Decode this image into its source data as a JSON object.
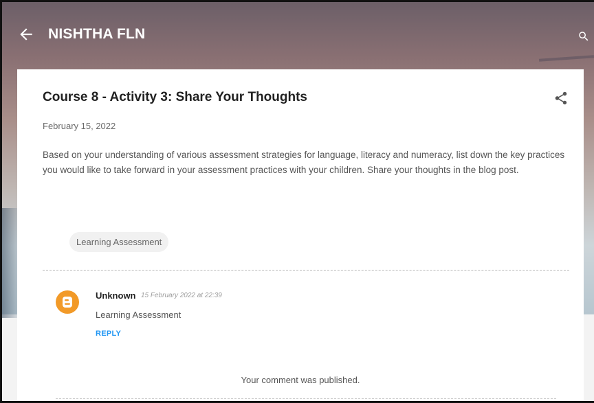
{
  "header": {
    "blog_title": "NISHTHA FLN",
    "back_icon": "arrow-left-icon",
    "search_icon": "search-icon"
  },
  "post": {
    "title": "Course 8 - Activity 3: Share Your Thoughts",
    "date": "February 15, 2022",
    "body": "Based on your understanding of various assessment strategies for language, literacy and numeracy, list down the key practices you would like to take forward in your assessment practices with your children. Share your thoughts in the blog post.",
    "label": "Learning Assessment",
    "share_icon": "share-icon"
  },
  "comments": [
    {
      "author": "Unknown",
      "date": "15 February 2022 at 22:39",
      "text": "Learning Assessment",
      "reply_label": "REPLY",
      "avatar_icon": "blogger-icon"
    }
  ],
  "status": {
    "published_message": "Your comment was published."
  },
  "colors": {
    "accent": "#2196f3",
    "avatar": "#f29a28",
    "title_text": "#212121",
    "body_text": "#555555"
  }
}
